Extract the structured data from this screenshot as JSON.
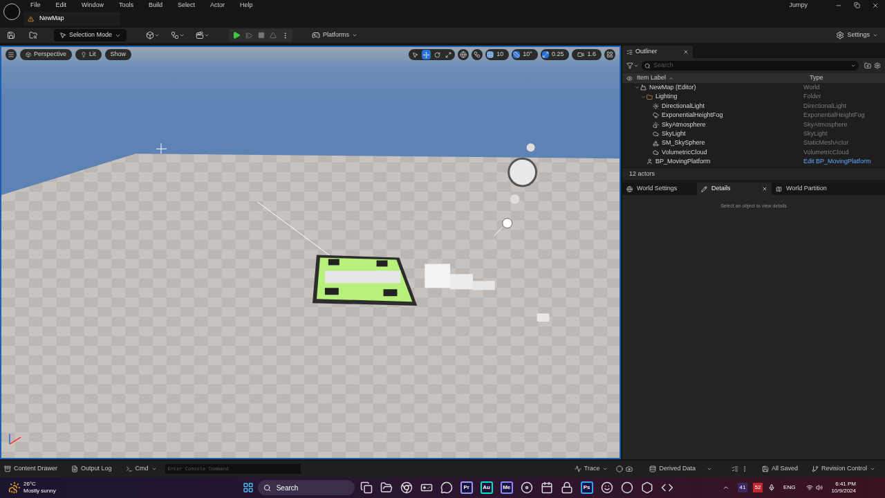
{
  "menu": [
    "File",
    "Edit",
    "Window",
    "Tools",
    "Build",
    "Select",
    "Actor",
    "Help"
  ],
  "project": "Jumpy",
  "document_tab": "NewMap",
  "toolbar": {
    "mode": "Selection Mode",
    "platforms": "Platforms",
    "settings": "Settings"
  },
  "viewport": {
    "buttons": [
      "Perspective",
      "Lit",
      "Show"
    ],
    "transform_tools": [
      {
        "kind": "select",
        "selected": false
      },
      {
        "kind": "move",
        "selected": true
      },
      {
        "kind": "rotate",
        "selected": false
      },
      {
        "kind": "scale",
        "selected": false
      }
    ],
    "grid_snap": "10",
    "rotation_snap": "10°",
    "scale_snap": "0.25",
    "camera_speed": "1.6"
  },
  "outliner": {
    "title": "Outliner",
    "search_placeholder": "Search",
    "columns": [
      "Item Label",
      "Type"
    ],
    "tree": [
      {
        "label": "NewMap (Editor)",
        "type": "World",
        "kind": "world",
        "expanded": true,
        "children": [
          {
            "label": "Lighting",
            "type": "Folder",
            "kind": "folder",
            "expanded": true,
            "children": [
              {
                "label": "DirectionalLight",
                "type": "DirectionalLight",
                "kind": "sun"
              },
              {
                "label": "ExponentialHeightFog",
                "type": "ExponentialHeightFog",
                "kind": "fog"
              },
              {
                "label": "SkyAtmosphere",
                "type": "SkyAtmosphere",
                "kind": "atmosphere"
              },
              {
                "label": "SkyLight",
                "type": "SkyLight",
                "kind": "skylight"
              },
              {
                "label": "SM_SkySphere",
                "type": "StaticMeshActor",
                "kind": "mesh"
              },
              {
                "label": "VolumetricCloud",
                "type": "VolumetricCloud",
                "kind": "cloud"
              }
            ]
          },
          {
            "label": "BP_MovingPlatform",
            "type": "Edit BP_MovingPlatform",
            "kind": "actor",
            "type_link": true
          }
        ]
      }
    ],
    "count": "12 actors"
  },
  "details": {
    "tabs": [
      {
        "label": "World Settings",
        "kind": "globe",
        "selected": false
      },
      {
        "label": "Details",
        "kind": "pencil",
        "selected": true
      },
      {
        "label": "World Partition",
        "kind": "map",
        "selected": false
      }
    ],
    "empty_message": "Select an object to view details"
  },
  "bottom_bar": {
    "content_drawer": "Content Drawer",
    "output_log": "Output Log",
    "cmd": "Cmd",
    "console_placeholder": "Enter Console Command",
    "trace": "Trace",
    "derived_data": "Derived Data",
    "saved": "All Saved",
    "revision_control": "Revision Control"
  },
  "taskbar": {
    "temperature": "26°C",
    "weather": "Mostly sunny",
    "search": "Search",
    "apps": [
      {
        "kind": "files"
      },
      {
        "kind": "explorer"
      },
      {
        "kind": "browser"
      },
      {
        "kind": "xbox"
      },
      {
        "kind": "chat"
      },
      {
        "kind": "letters",
        "label": "Pr",
        "color": "#9999ff"
      },
      {
        "kind": "letters",
        "label": "Au",
        "color": "#00e4bb"
      },
      {
        "kind": "letters",
        "label": "Me",
        "color": "#8a8aff"
      },
      {
        "kind": "blender"
      },
      {
        "kind": "calendar"
      },
      {
        "kind": "lock"
      },
      {
        "kind": "letters",
        "label": "Ps",
        "color": "#31a8ff"
      },
      {
        "kind": "smile"
      },
      {
        "kind": "record"
      },
      {
        "kind": "engine"
      },
      {
        "kind": "studio"
      }
    ],
    "tray": [
      "41",
      "52"
    ],
    "language": "ENG",
    "time": "6:41 PM",
    "date": "10/9/2024"
  }
}
